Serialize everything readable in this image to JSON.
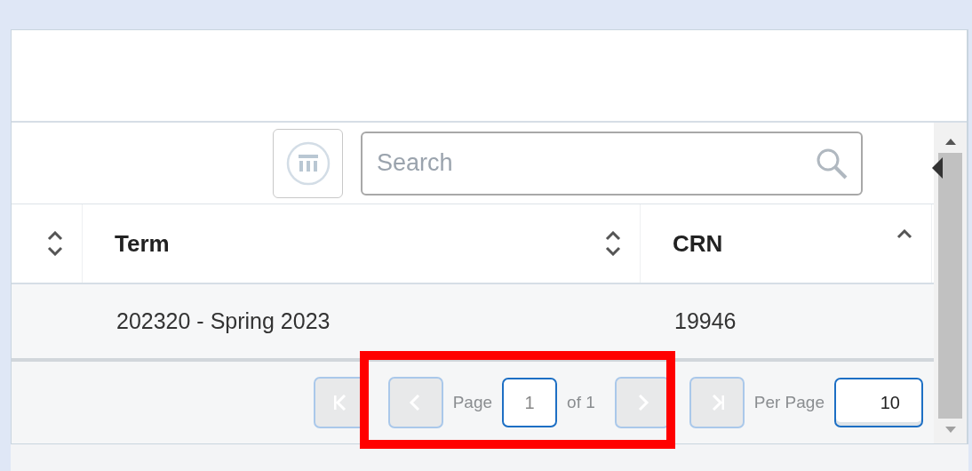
{
  "toolbar": {
    "columns_button": {
      "disabled": false
    },
    "search": {
      "placeholder": "Search"
    }
  },
  "table": {
    "columns": [
      {
        "sorted": false
      },
      {
        "label": "Term",
        "sorted": false
      },
      {
        "label": "CRN",
        "sorted": true
      }
    ],
    "rows": [
      {
        "cells": [
          "",
          "202320 - Spring 2023",
          "19946"
        ]
      }
    ]
  },
  "pager": {
    "buttons": [
      {
        "kind": "first",
        "disabled": true
      },
      {
        "kind": "prev",
        "disabled": true
      },
      {
        "kind": "next",
        "disabled": true
      },
      {
        "kind": "last",
        "disabled": true
      }
    ],
    "page_label": "Page",
    "page_value": "1",
    "of_label": "of 1",
    "per_page_label": "Per Page",
    "per_page_value": "10"
  },
  "highlight_box": true
}
